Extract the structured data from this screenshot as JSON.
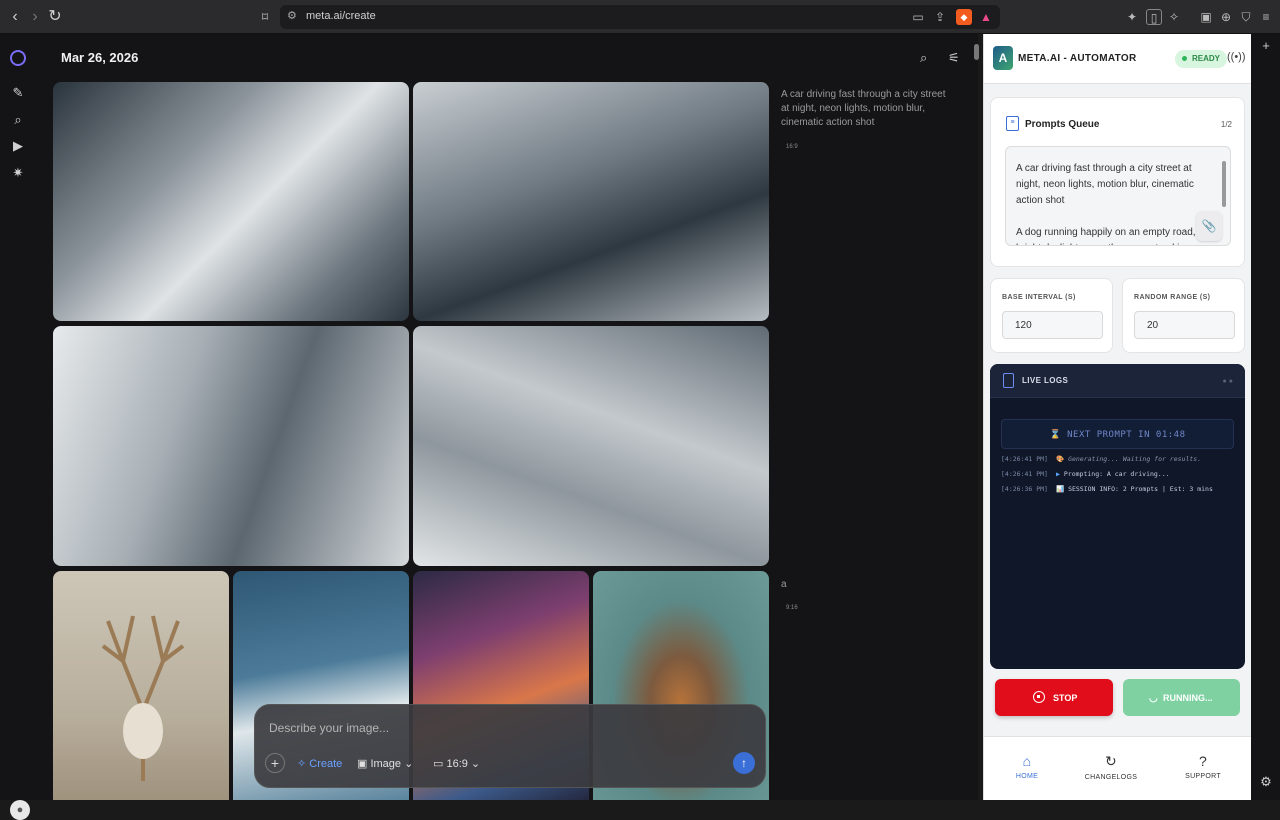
{
  "browser": {
    "url": "meta.ai/create"
  },
  "main": {
    "date": "Mar 26, 2026",
    "captions": [
      {
        "text": "A car driving fast through a city street at night, neon lights, motion blur, cinematic action shot",
        "ratio": "16:9"
      },
      {
        "text": "a",
        "ratio": "9:16"
      }
    ],
    "composer": {
      "placeholder": "Describe your image...",
      "create_label": "Create",
      "type_label": "Image",
      "ratio_label": "16:9"
    }
  },
  "panel": {
    "title": "META.AI - AUTOMATOR",
    "status": "READY",
    "queue": {
      "title": "Prompts Queue",
      "count": "1/2",
      "prompts": [
        "A car driving fast through a city street at night, neon lights, motion blur, cinematic action shot",
        "A dog running happily on an empty road, bright daylight, smooth camera tracking, energetic vibe"
      ]
    },
    "base_interval": {
      "label": "BASE INTERVAL (S)",
      "value": "120"
    },
    "random_range": {
      "label": "RANDOM RANGE (S)",
      "value": "20"
    },
    "logs": {
      "title": "LIVE LOGS",
      "next_prompt": "⌛ NEXT PROMPT IN 01:48",
      "lines": [
        {
          "time": "[4:26:41 PM]",
          "icon": "🎨",
          "text": "Generating... Waiting for results."
        },
        {
          "time": "[4:26:41 PM]",
          "icon": "▶",
          "text": "Prompting: A car driving..."
        },
        {
          "time": "[4:26:36 PM]",
          "icon": "📊",
          "text": "SESSION INFO: 2 Prompts | Est: 3 mins"
        }
      ]
    },
    "stop_label": "STOP",
    "running_label": "RUNNING...",
    "tabs": [
      {
        "label": "HOME",
        "icon": "home-icon"
      },
      {
        "label": "CHANGELOGS",
        "icon": "history-icon"
      },
      {
        "label": "SUPPORT",
        "icon": "help-icon"
      }
    ]
  },
  "colors": {
    "accent": "#3a6fd6",
    "stop": "#e10d1a",
    "running": "#7fd1a1",
    "ready": "#2c8a46"
  }
}
